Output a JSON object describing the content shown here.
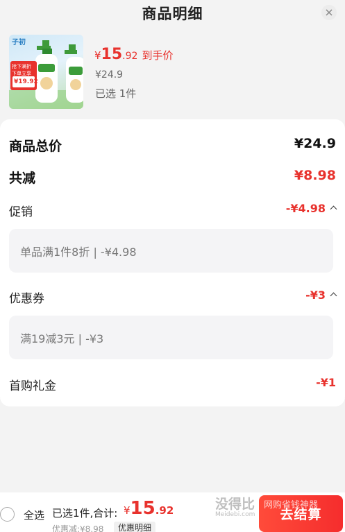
{
  "header": {
    "title": "商品明细"
  },
  "product": {
    "thumb_brand": "子初",
    "thumb_promo": [
      "抢下满折",
      "下单立享"
    ],
    "thumb_price": "¥19.92",
    "price_yen": "¥",
    "price_int": "15",
    "price_dec": ".92",
    "price_tag": "到手价",
    "original_price": "¥24.9",
    "selected_count": "已选 1件"
  },
  "summary": {
    "total_label": "商品总价",
    "total_value": "¥24.9",
    "reduced_label": "共减",
    "reduced_value": "¥8.98"
  },
  "promotion": {
    "label": "促销",
    "value": "-¥4.98",
    "detail": "单品满1件8折 | -¥4.98"
  },
  "coupon": {
    "label": "优惠券",
    "value": "-¥3",
    "detail": "满19减3元 | -¥3"
  },
  "first_gift": {
    "label": "首购礼金",
    "value": "-¥1"
  },
  "bottom": {
    "select_all": "全选",
    "sum_label": "已选1件,合计:",
    "sum_yen": "¥",
    "sum_int": "15",
    "sum_dec": ".92",
    "discount": "优惠减:¥8.98",
    "detail_button": "优惠明细",
    "checkout": "去结算"
  },
  "watermark": {
    "main": "没得比",
    "sub": "Meidebi.com",
    "right": "网购省钱神器"
  },
  "colors": {
    "accent": "#e8322d",
    "checkout": "#f52d2d"
  }
}
